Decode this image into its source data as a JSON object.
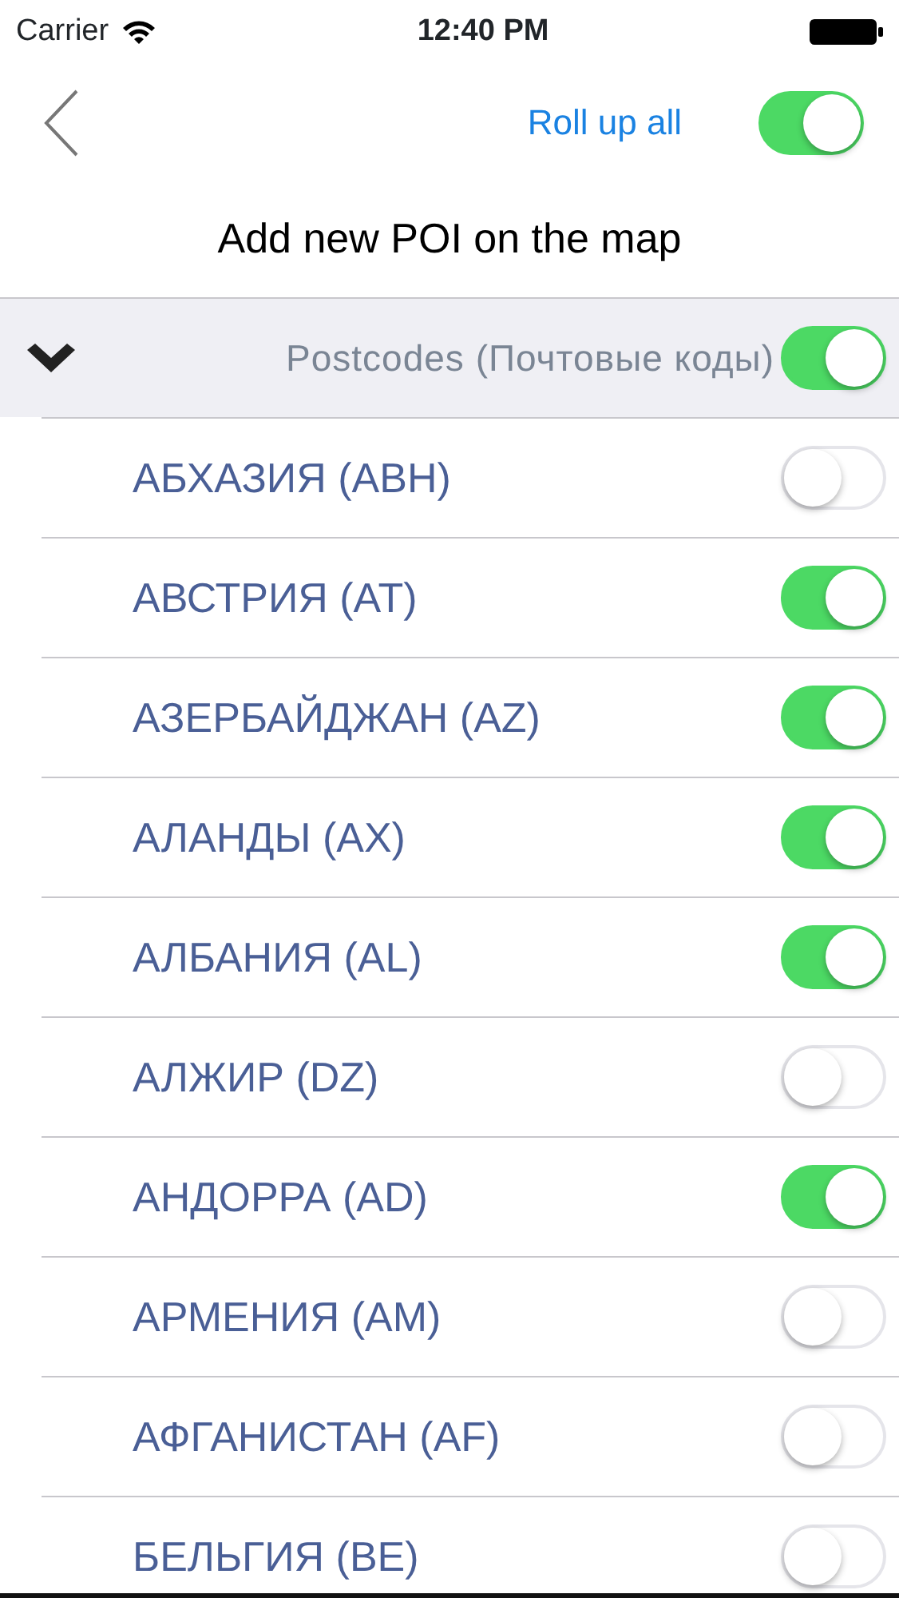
{
  "status_bar": {
    "carrier": "Carrier",
    "time": "12:40 PM"
  },
  "nav_bar": {
    "action": "Roll up all",
    "toggle_on": true
  },
  "title": "Add new POI on the map",
  "group": {
    "label": "Postcodes (Почтовые коды)",
    "expanded": true,
    "on": true,
    "items": [
      {
        "label": "АБХАЗИЯ (ABH)",
        "on": false
      },
      {
        "label": "АВСТРИЯ (AT)",
        "on": true
      },
      {
        "label": "АЗЕРБАЙДЖАН (AZ)",
        "on": true
      },
      {
        "label": "АЛАНДЫ (AX)",
        "on": true
      },
      {
        "label": "АЛБАНИЯ (AL)",
        "on": true
      },
      {
        "label": "АЛЖИР (DZ)",
        "on": false
      },
      {
        "label": "АНДОРРА (AD)",
        "on": true
      },
      {
        "label": "АРМЕНИЯ (AM)",
        "on": false
      },
      {
        "label": "АФГАНИСТАН (AF)",
        "on": false
      },
      {
        "label": "БЕЛЬГИЯ (BE)",
        "on": false
      }
    ]
  }
}
